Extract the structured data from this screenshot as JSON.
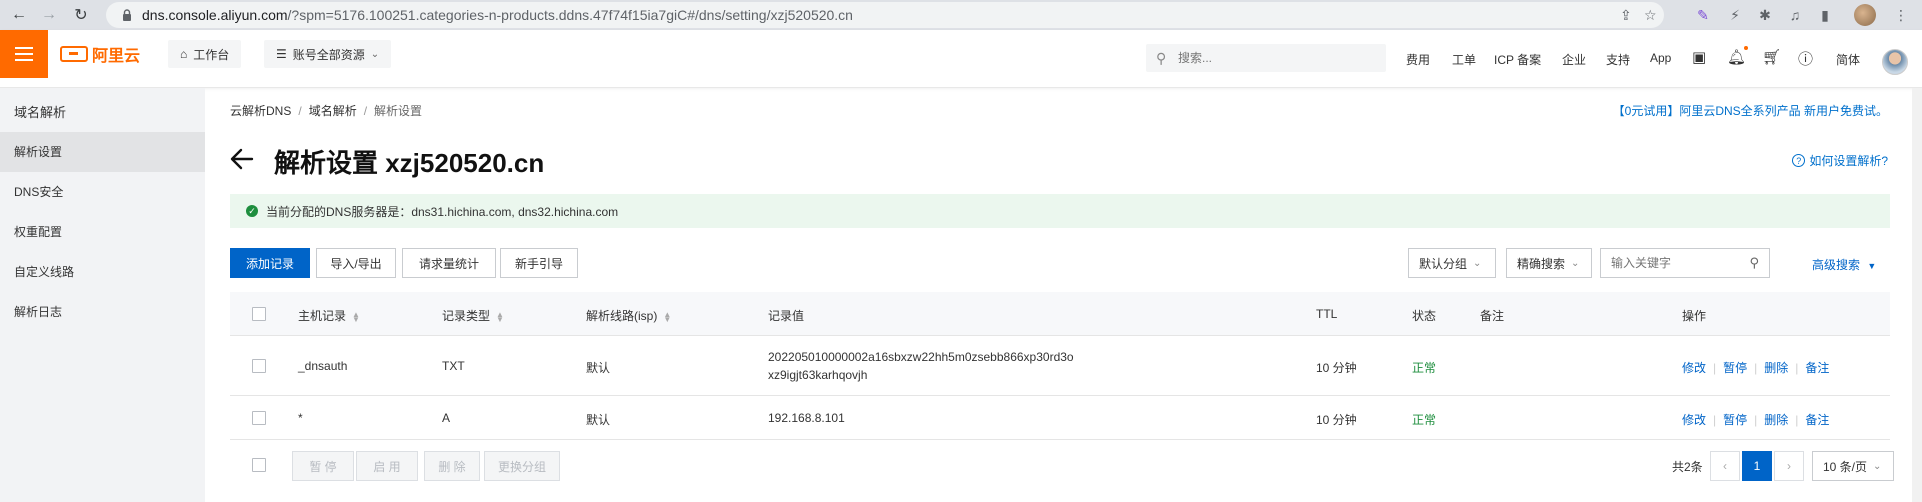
{
  "browser": {
    "url_host": "dns.console.aliyun.com",
    "url_rest": "/?spm=5176.100251.categories-n-products.ddns.47f74f15ia7giC#/dns/setting/xzj520520.cn"
  },
  "topbar": {
    "logo_text": "阿里云",
    "workbench": "工作台",
    "account_resources": "账号全部资源",
    "search_placeholder": "搜索...",
    "nav": [
      "费用",
      "工单",
      "ICP 备案",
      "企业",
      "支持",
      "App"
    ],
    "lang": "简体"
  },
  "sidebar": {
    "title": "域名解析",
    "items": [
      {
        "label": "解析设置",
        "active": true
      },
      {
        "label": "DNS安全",
        "active": false
      },
      {
        "label": "权重配置",
        "active": false
      },
      {
        "label": "自定义线路",
        "active": false
      },
      {
        "label": "解析日志",
        "active": false
      }
    ]
  },
  "breadcrumb": [
    "云解析DNS",
    "域名解析",
    "解析设置"
  ],
  "promo": "【0元试用】阿里云DNS全系列产品 新用户免费试。",
  "page_title": "解析设置 xzj520520.cn",
  "help_link": "如何设置解析?",
  "notice": "当前分配的DNS服务器是：dns31.hichina.com, dns32.hichina.com",
  "toolbar": {
    "add": "添加记录",
    "import_export": "导入/导出",
    "stats": "请求量统计",
    "guide": "新手引导",
    "group": "默认分组",
    "precise": "精确搜索",
    "keyword_placeholder": "输入关键字",
    "advanced": "高级搜索"
  },
  "table": {
    "headers": {
      "host": "主机记录",
      "type": "记录类型",
      "line": "解析线路(isp)",
      "value": "记录值",
      "ttl": "TTL",
      "status": "状态",
      "remark": "备注",
      "ops": "操作"
    },
    "rows": [
      {
        "host": "_dnsauth",
        "type": "TXT",
        "line": "默认",
        "value_line1": "202205010000002a16sbxzw22hh5m0zsebb866xp30rd3o",
        "value_line2": "xz9igjt63karhqovjh",
        "ttl": "10 分钟",
        "status": "正常",
        "remark": ""
      },
      {
        "host": "*",
        "type": "A",
        "line": "默认",
        "value_line1": "192.168.8.101",
        "value_line2": "",
        "ttl": "10 分钟",
        "status": "正常",
        "remark": ""
      }
    ],
    "row_ops": [
      "修改",
      "暂停",
      "删除",
      "备注"
    ]
  },
  "bulk": {
    "pause": "暂 停",
    "enable": "启 用",
    "delete": "删 除",
    "change_group": "更换分组"
  },
  "pagination": {
    "total": "共2条",
    "current": "1",
    "page_size": "10 条/页"
  },
  "colors": {
    "brand": "#ff6a00",
    "primary": "#0064c8",
    "link": "#0070cc",
    "success": "#1e8e3e"
  }
}
